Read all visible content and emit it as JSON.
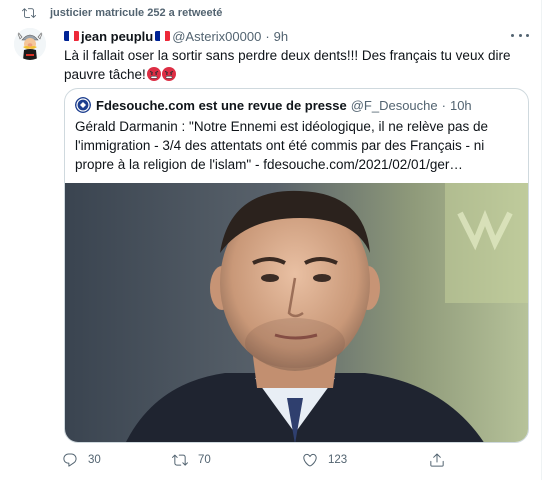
{
  "retweet_banner": {
    "text": "justicier matricule 252 a retweeté",
    "icon": "retweet-icon"
  },
  "tweet": {
    "display_name": "jean peuplu",
    "handle": "@Asterix00000",
    "separator": "·",
    "time": "9h",
    "text": "Là il fallait oser la sortir sans perdre deux dents!!! Des français tu veux dire pauvre tâche!",
    "emojis": [
      "angry-face-icon",
      "angry-face-icon"
    ]
  },
  "quote": {
    "display_name": "Fdesouche.com est une revue de presse",
    "handle": "@F_Desouche",
    "separator": "·",
    "time": "10h",
    "text": "Gérald Darmanin : \"Notre Ennemi est idéologique, il ne relève pas de l'immigration - 3/4 des attentats ont été commis par des Français - ni propre à la religion de l'islam\" - fdesouche.com/2021/02/01/ger…"
  },
  "actions": {
    "reply_count": "30",
    "retweet_count": "70",
    "like_count": "123"
  },
  "colors": {
    "text": "#0f1419",
    "secondary": "#536471",
    "border": "#cfd9de",
    "flag_blue": "#002395",
    "flag_red": "#ed2939"
  }
}
